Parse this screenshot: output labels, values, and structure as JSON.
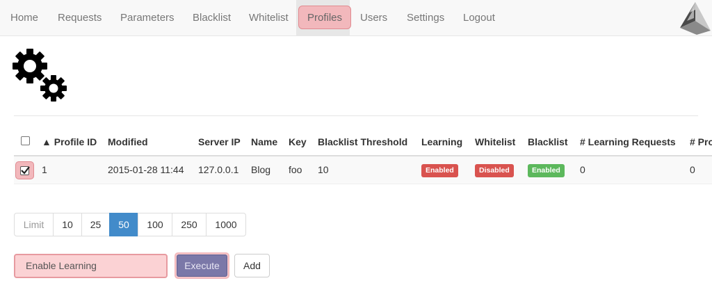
{
  "nav": {
    "items": [
      "Home",
      "Requests",
      "Parameters",
      "Blacklist",
      "Whitelist",
      "Profiles",
      "Users",
      "Settings",
      "Logout"
    ],
    "active": "Profiles"
  },
  "table": {
    "headers": {
      "profile_id": "▲ Profile ID",
      "modified": "Modified",
      "server_ip": "Server IP",
      "name": "Name",
      "key": "Key",
      "blacklist_threshold": "Blacklist Threshold",
      "learning": "Learning",
      "whitelist": "Whitelist",
      "blacklist": "Blacklist",
      "learning_requests": "# Learning Requests",
      "profile_requests": "# Pro"
    },
    "rows": [
      {
        "selected": true,
        "profile_id": "1",
        "modified": "2015-01-28 11:44",
        "server_ip": "127.0.0.1",
        "name": "Blog",
        "key": "foo",
        "blacklist_threshold": "10",
        "learning": "Enabled",
        "whitelist": "Disabled",
        "blacklist": "Enabled",
        "learning_requests": "0",
        "profile_requests": "0"
      }
    ]
  },
  "pagination": {
    "label": "Limit",
    "options": [
      "10",
      "25",
      "50",
      "100",
      "250",
      "1000"
    ],
    "active": "50"
  },
  "actions": {
    "selected_action": "Enable Learning",
    "execute_label": "Execute",
    "add_label": "Add"
  },
  "colors": {
    "enabled": "#5cb85c",
    "disabled": "#d9534f",
    "pagination_active": "#428bca",
    "highlight": "#f2b8bc"
  }
}
